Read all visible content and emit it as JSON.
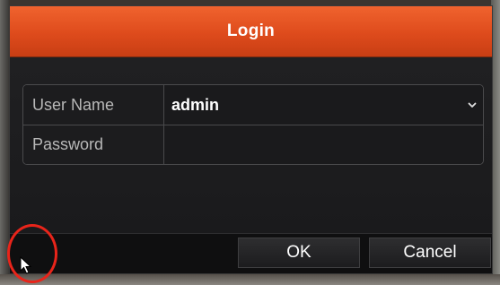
{
  "dialog": {
    "title": "Login"
  },
  "form": {
    "username_label": "User Name",
    "username_value": "admin",
    "password_label": "Password",
    "password_value": ""
  },
  "buttons": {
    "ok_label": "OK",
    "cancel_label": "Cancel"
  },
  "icons": {
    "dropdown": "chevron-down-icon",
    "pointer": "mouse-cursor-icon"
  },
  "colors": {
    "titlebar": "#e5531f",
    "annotation": "#e8241a"
  }
}
